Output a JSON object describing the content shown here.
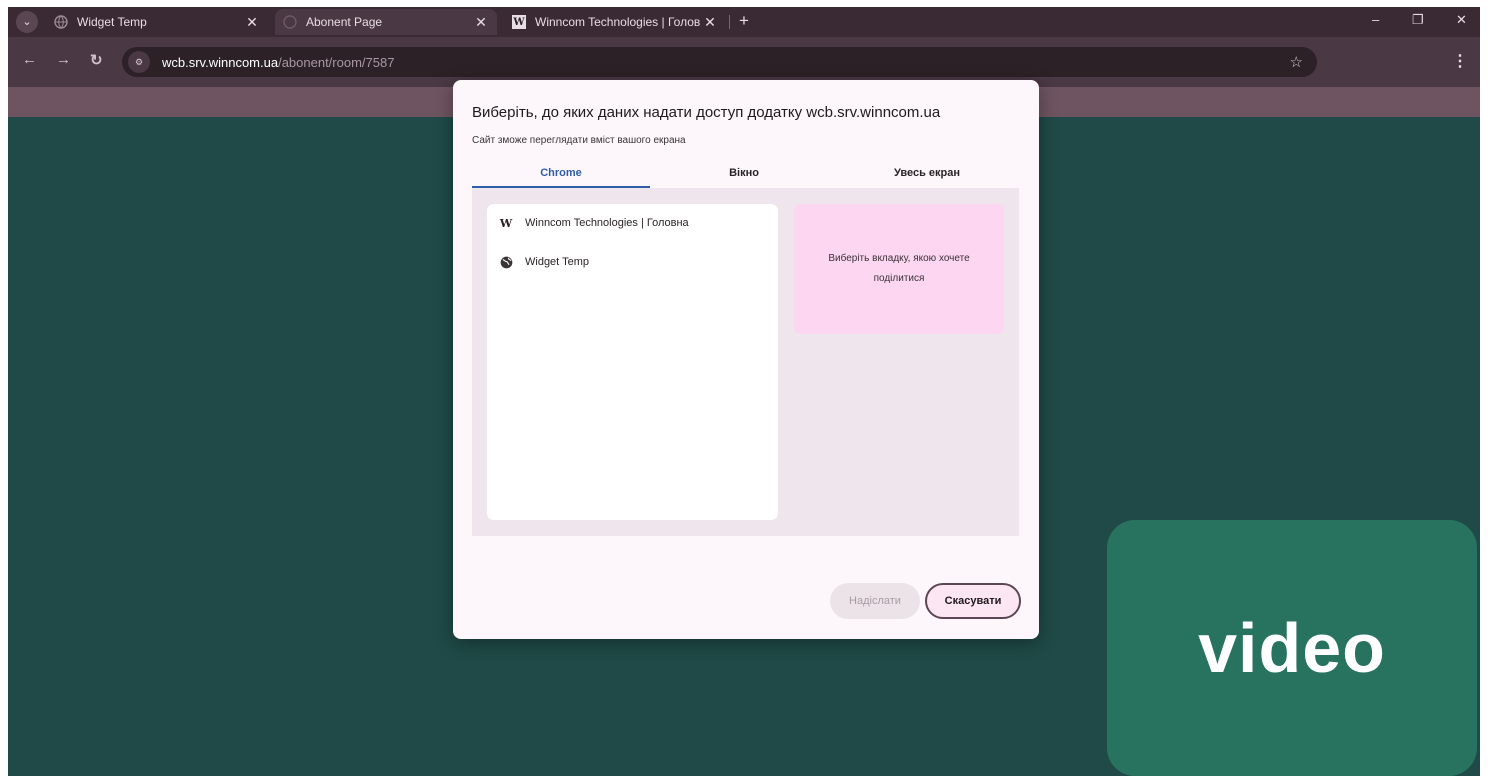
{
  "browser": {
    "tabs": [
      {
        "title": "Widget Temp",
        "active": false
      },
      {
        "title": "Abonent Page",
        "active": true
      },
      {
        "title": "Winncom Technologies | Голов",
        "active": false
      }
    ],
    "new_tab": "+",
    "window_controls": {
      "minimize": "–",
      "restore": "❐",
      "close": "✕"
    },
    "address": {
      "domain": "wcb.srv.winncom.ua",
      "path": "/abonent/room/7587"
    },
    "tab_logo_letter": "W"
  },
  "dialog": {
    "title": "Виберіть, до яких даних надати доступ додатку wcb.srv.winncom.ua",
    "subtitle": "Сайт зможе переглядати вміст вашого екрана",
    "tabs": [
      {
        "label": "Chrome",
        "active": true
      },
      {
        "label": "Вікно",
        "active": false
      },
      {
        "label": "Увесь екран",
        "active": false
      }
    ],
    "list": [
      {
        "title": "Winncom Technologies | Головна",
        "icon": "winncom-logo-icon"
      },
      {
        "title": "Widget Temp",
        "icon": "globe-icon"
      }
    ],
    "preview_text": "Виберіть вкладку, якою хочете поділитися",
    "buttons": {
      "send": "Надіслати",
      "cancel": "Скасувати"
    }
  },
  "video_tile": {
    "label": "video"
  },
  "colors": {
    "browser_frame": "#4a3844",
    "page_background": "#1f4a47",
    "video_tile": "#287360",
    "active_tab_accent": "#2f5da8",
    "preview_pink": "#fdd6f1"
  }
}
